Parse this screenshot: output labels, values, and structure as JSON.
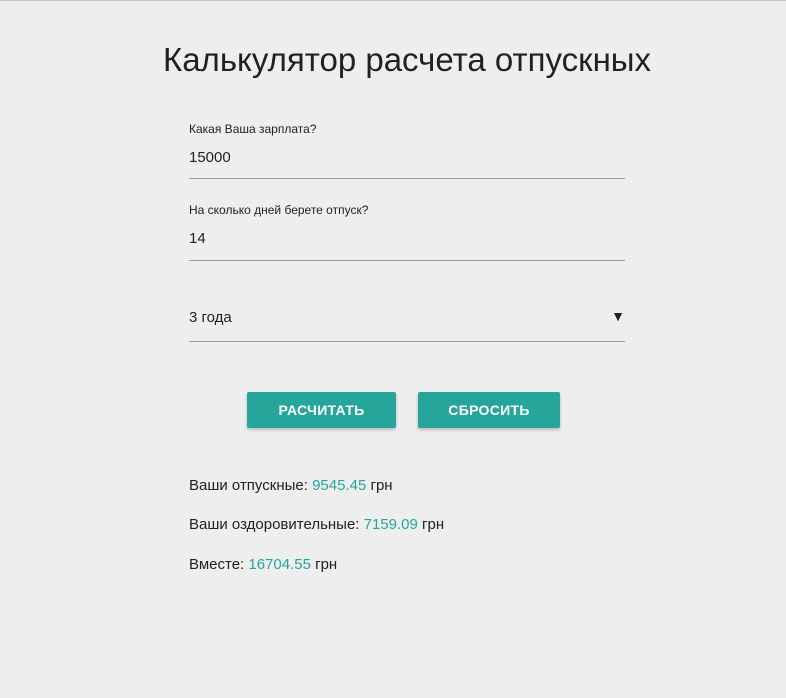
{
  "page": {
    "title": "Калькулятор расчета отпускных"
  },
  "form": {
    "salary": {
      "label": "Какая Ваша зарплата?",
      "value": "15000"
    },
    "days": {
      "label": "На сколько дней берете отпуск?",
      "value": "14"
    },
    "experience": {
      "selected": "3 года",
      "arrow": "▼"
    }
  },
  "buttons": {
    "calculate": "РАСЧИТАТЬ",
    "reset": "СБРОСИТЬ"
  },
  "results": {
    "vacation": {
      "label": "Ваши отпускные: ",
      "value": "9545.45",
      "unit": " грн"
    },
    "health": {
      "label": "Ваши оздоровительные: ",
      "value": "7159.09",
      "unit": " грн"
    },
    "total": {
      "label": "Вместе: ",
      "value": "16704.55",
      "unit": " грн"
    }
  },
  "colors": {
    "accent": "#26a69a",
    "background": "#eeeeee",
    "text": "#212121",
    "underline": "#9e9e9e"
  }
}
